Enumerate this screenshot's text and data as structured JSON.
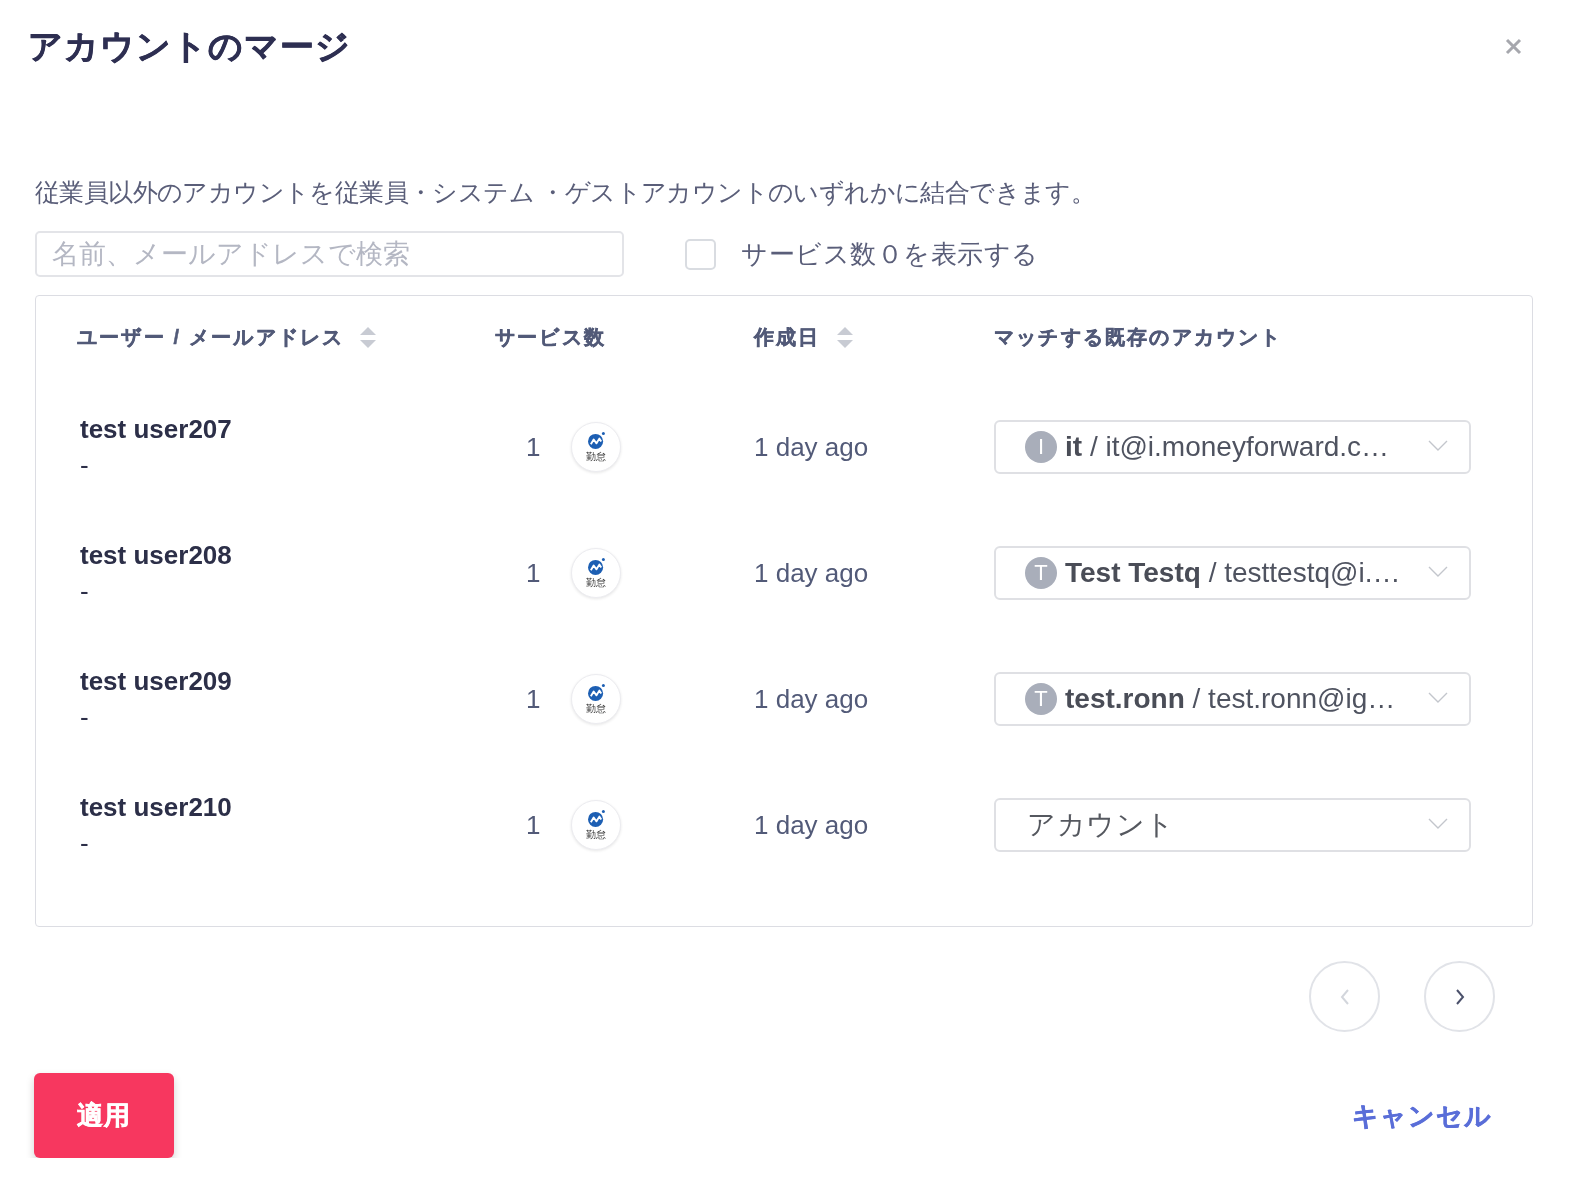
{
  "dialog": {
    "title": "アカウントのマージ"
  },
  "description": "従業員以外のアカウントを従業員・システム ・ゲストアカウントのいずれかに結合できます。",
  "search": {
    "placeholder": "名前、メールアドレスで検索"
  },
  "show_zero_services": {
    "label": "サービス数０を表示する",
    "checked": false
  },
  "table": {
    "columns": [
      {
        "label": "ユーザー / メールアドレス",
        "sortable": true
      },
      {
        "label": "サービス数",
        "sortable": false
      },
      {
        "label": "作成日",
        "sortable": true
      },
      {
        "label": "マッチする既存のアカウント",
        "sortable": false
      }
    ],
    "rows": [
      {
        "user": "test user207",
        "email": "-",
        "service_count": "1",
        "service_label": "勤怠",
        "created": "1 day ago",
        "match": {
          "kind": "account",
          "initial": "I",
          "value": "**it** / it@i.moneyforward.c…"
        }
      },
      {
        "user": "test user208",
        "email": "-",
        "service_count": "1",
        "service_label": "勤怠",
        "created": "1 day ago",
        "match": {
          "kind": "account",
          "initial": "T",
          "value": "**Test Testq** / testtestq@i.…"
        }
      },
      {
        "user": "test user209",
        "email": "-",
        "service_count": "1",
        "service_label": "勤怠",
        "created": "1 day ago",
        "match": {
          "kind": "account",
          "initial": "T",
          "value": "**test.ronn** / test.ronn@ig…"
        }
      },
      {
        "user": "test user210",
        "email": "-",
        "service_count": "1",
        "service_label": "勤怠",
        "created": "1 day ago",
        "match": {
          "kind": "empty",
          "placeholder": "アカウント"
        }
      }
    ]
  },
  "pagination": {
    "previous": {
      "disabled": true
    },
    "next": {
      "disabled": false
    }
  },
  "buttons": {
    "apply": "適用",
    "cancel": "キャンセル"
  }
}
